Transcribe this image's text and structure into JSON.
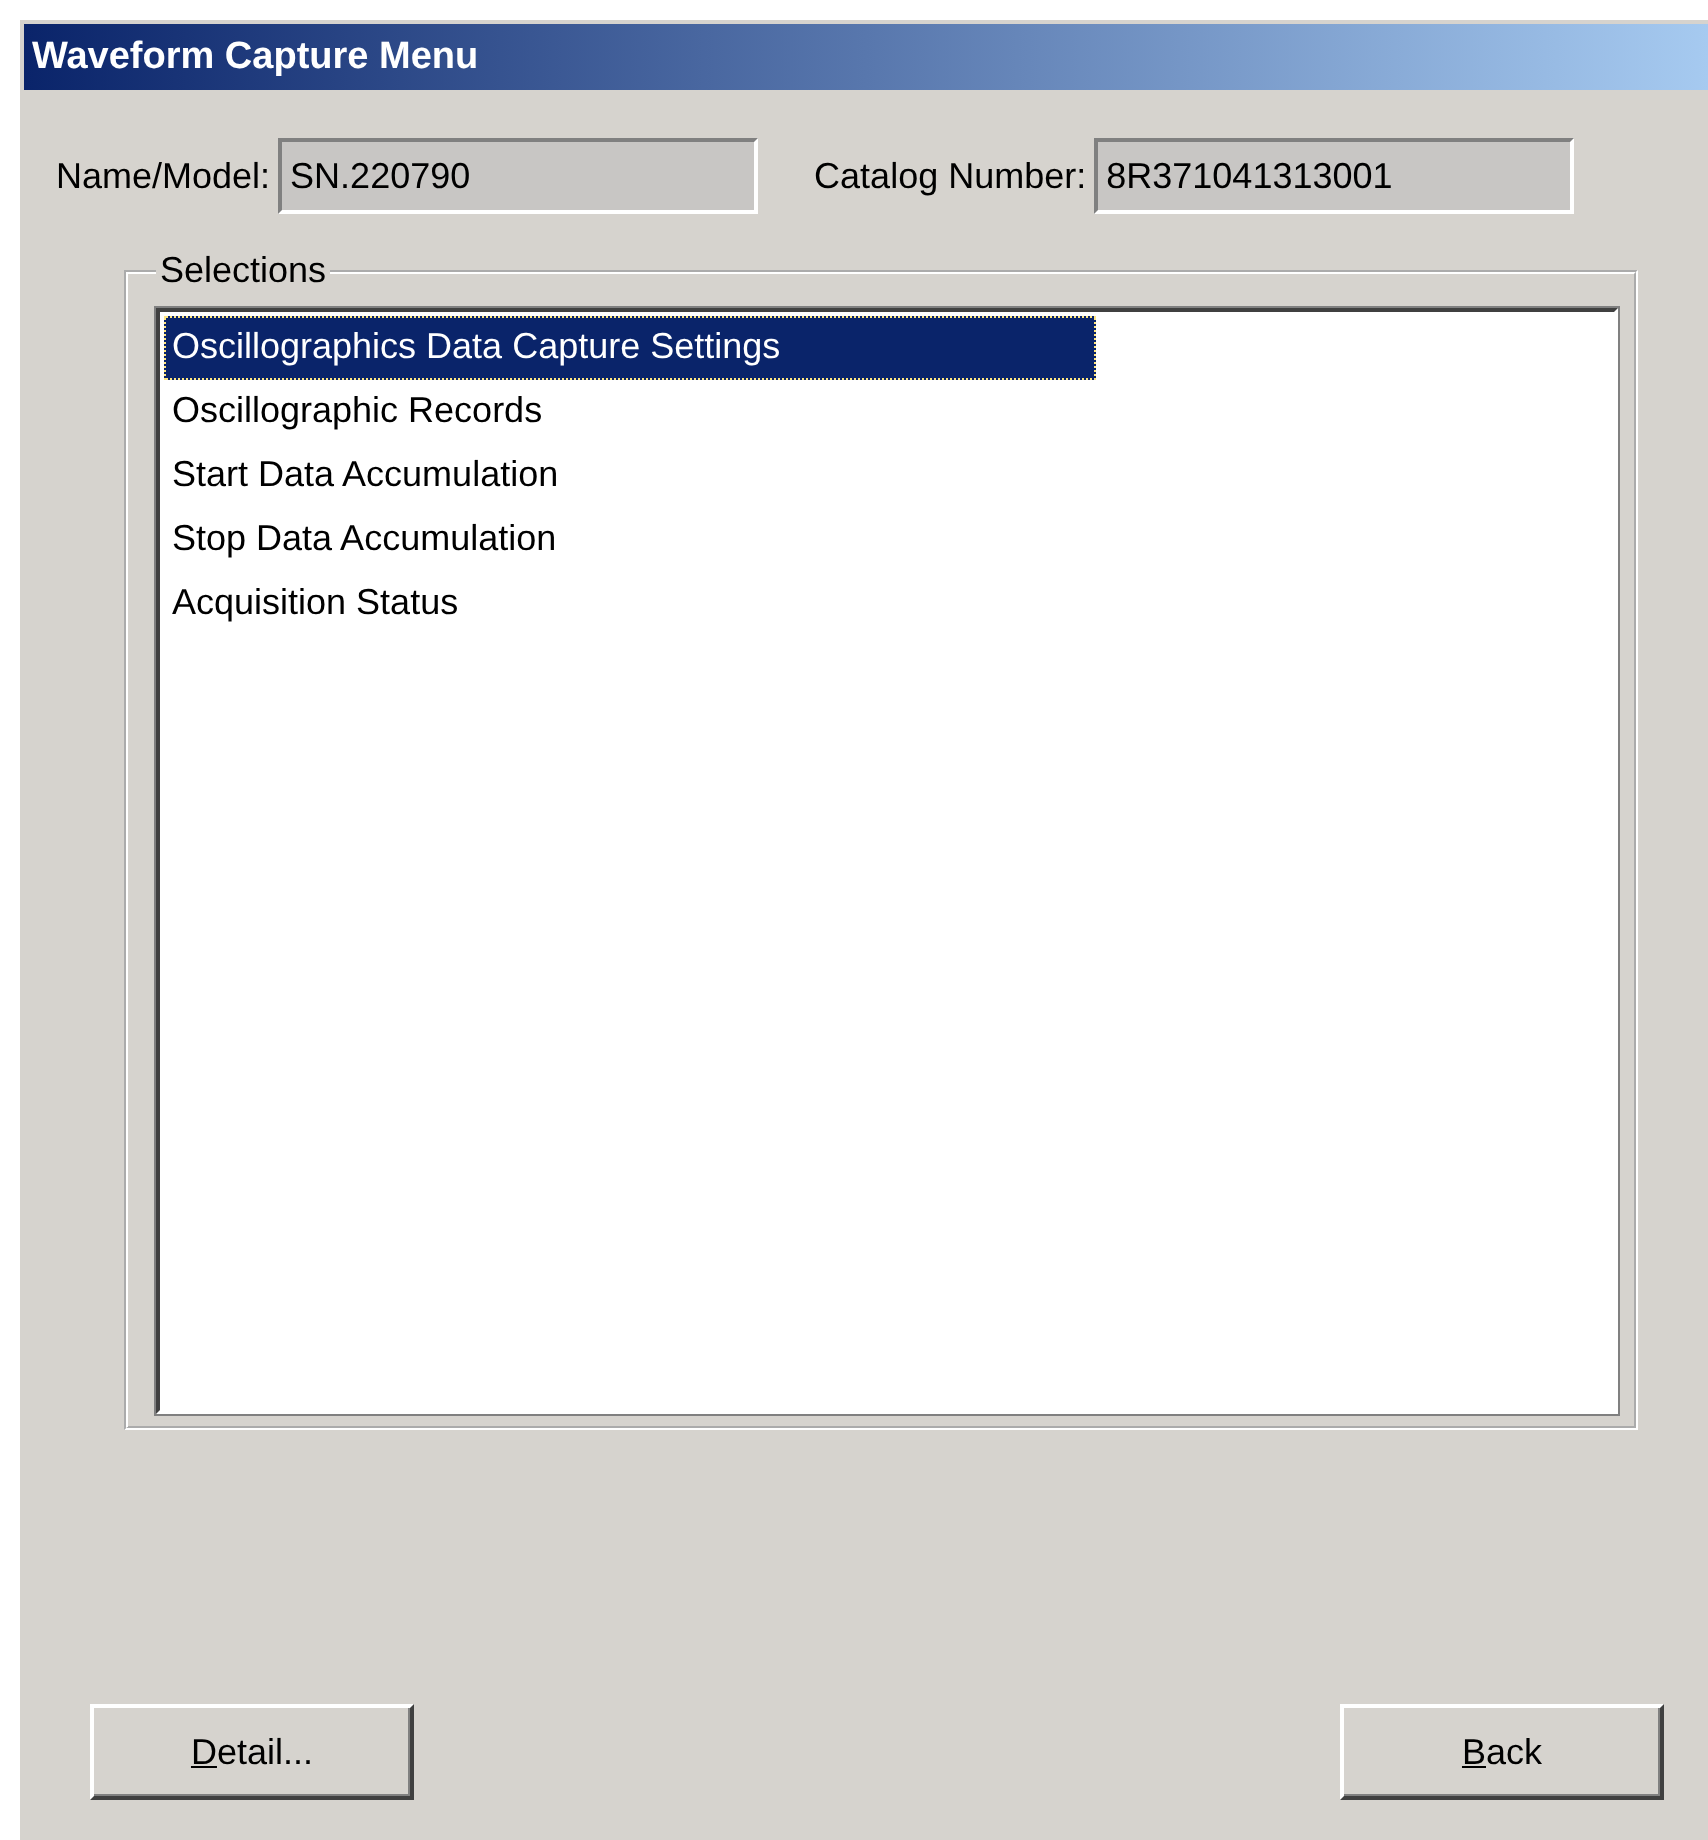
{
  "window": {
    "title": "Waveform Capture Menu"
  },
  "fields": [
    {
      "label": "Name/Model:",
      "value": "SN.220790"
    },
    {
      "label": "Catalog Number:",
      "value": "8R371041313001"
    }
  ],
  "selections": {
    "title": "Selections",
    "items": [
      {
        "label": "Oscillographics Data Capture Settings",
        "selected": true
      },
      {
        "label": "Oscillographic Records",
        "selected": false
      },
      {
        "label": "Start Data Accumulation",
        "selected": false
      },
      {
        "label": "Stop Data Accumulation",
        "selected": false
      },
      {
        "label": "Acquisition Status",
        "selected": false
      }
    ]
  },
  "buttons": [
    {
      "label": "Detail..."
    },
    {
      "label": "Back"
    }
  ]
}
